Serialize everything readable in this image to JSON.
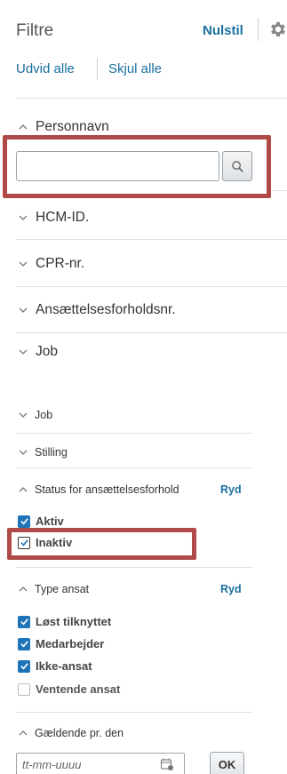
{
  "header": {
    "title": "Filtre",
    "reset_label": "Nulstil",
    "settings_icon": "gear-icon"
  },
  "toolbar": {
    "expand_all": "Udvid alle",
    "collapse_all": "Skjul alle"
  },
  "sections_large": [
    {
      "label": "Personnavn",
      "expanded": true
    },
    {
      "label": "HCM-ID.",
      "expanded": false
    },
    {
      "label": "CPR-nr.",
      "expanded": false
    },
    {
      "label": "Ansættelsesforholdsnr.",
      "expanded": false
    },
    {
      "label": "Job",
      "expanded": false
    }
  ],
  "search": {
    "value": "",
    "placeholder": "",
    "button_icon": "search-icon"
  },
  "sections_small": {
    "job": "Job",
    "position": "Stilling"
  },
  "employment_status": {
    "label": "Status for ansættelsesforhold",
    "clear_label": "Ryd",
    "options": [
      {
        "label": "Aktiv",
        "checked": true
      },
      {
        "label": "Inaktiv",
        "checked": true
      }
    ]
  },
  "employee_type": {
    "label": "Type ansat",
    "clear_label": "Ryd",
    "options": [
      {
        "label": "Løst tilknyttet",
        "checked": true
      },
      {
        "label": "Medarbejder",
        "checked": true
      },
      {
        "label": "Ikke-ansat",
        "checked": true
      },
      {
        "label": "Ventende ansat",
        "checked": false
      }
    ]
  },
  "effective_date": {
    "label": "Gældende pr. den",
    "value": "",
    "placeholder": "tt-mm-uuuu",
    "ok_label": "OK",
    "calendar_icon": "calendar-icon"
  },
  "colors": {
    "link": "#1a6fa0",
    "highlight_box": "#b04a47",
    "checkbox": "#1f73b7"
  }
}
